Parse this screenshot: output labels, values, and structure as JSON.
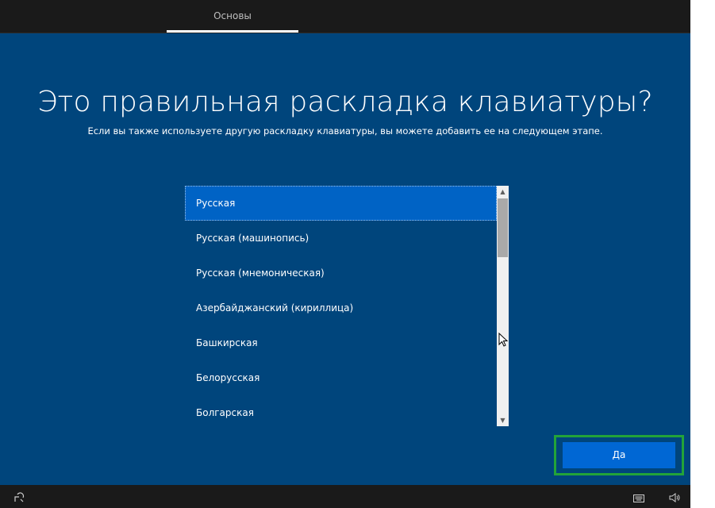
{
  "header": {
    "tab_label": "Основы"
  },
  "page": {
    "title": "Это правильная раскладка клавиатуры?",
    "subtitle": "Если вы также используете другую раскладку клавиатуры, вы можете добавить ее на следующем этапе."
  },
  "layouts": {
    "selected_index": 0,
    "items": [
      {
        "label": "Русская"
      },
      {
        "label": "Русская (машинопись)"
      },
      {
        "label": "Русская (мнемоническая)"
      },
      {
        "label": "Азербайджанский (кириллица)"
      },
      {
        "label": "Башкирская"
      },
      {
        "label": "Белорусская"
      },
      {
        "label": "Болгарская"
      }
    ]
  },
  "actions": {
    "yes_label": "Да"
  },
  "footer": {
    "icons": [
      "accessibility-icon",
      "keyboard-icon",
      "volume-icon"
    ]
  },
  "colors": {
    "background": "#00457c",
    "selected_item": "#0063c5",
    "button": "#0067d4",
    "focus_frame": "#23a339"
  }
}
